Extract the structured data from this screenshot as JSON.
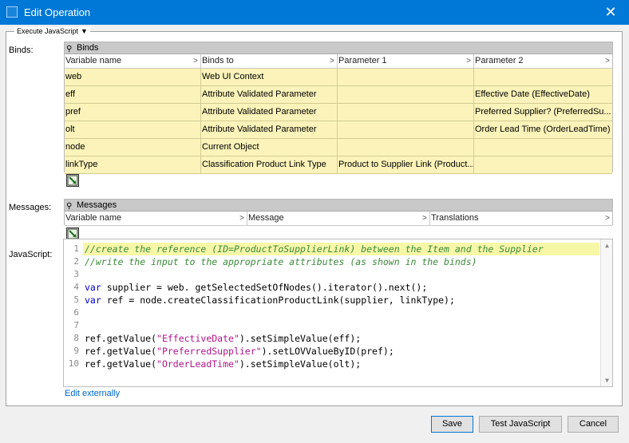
{
  "window": {
    "title": "Edit Operation",
    "close_glyph": "✕"
  },
  "panel": {
    "section_title": "Execute JavaScript",
    "section_caret": "▼"
  },
  "binds": {
    "label": "Binds:",
    "title": "Binds",
    "columns": [
      "Variable name",
      "Binds to",
      "Parameter 1",
      "Parameter 2"
    ],
    "rows": [
      [
        "web",
        "Web UI Context",
        "",
        ""
      ],
      [
        "eff",
        "Attribute Validated Parameter",
        "",
        "Effective Date (EffectiveDate)"
      ],
      [
        "pref",
        "Attribute Validated Parameter",
        "",
        "Preferred Supplier? (PreferredSu..."
      ],
      [
        "olt",
        "Attribute Validated Parameter",
        "",
        "Order Lead Time (OrderLeadTime)"
      ],
      [
        "node",
        "Current Object",
        "",
        ""
      ],
      [
        "linkType",
        "Classification Product Link Type",
        "Product to Supplier Link (Product...",
        ""
      ]
    ]
  },
  "messages": {
    "label": "Messages:",
    "title": "Messages",
    "columns": [
      "Variable name",
      "Message",
      "Translations"
    ]
  },
  "javascript": {
    "label": "JavaScript:",
    "line_numbers": [
      "1",
      "2",
      "3",
      "4",
      "5",
      "6",
      "7",
      "8",
      "9",
      "10"
    ],
    "edit_link": "Edit externally"
  },
  "icons": {
    "pin": "pin-icon",
    "add_row": "add-row-icon",
    "column_menu": "chevron-right-icon"
  },
  "buttons": {
    "save": "Save",
    "test": "Test JavaScript",
    "cancel": "Cancel"
  },
  "colors": {
    "titlebar": "#0078d7",
    "grid_cell": "#fbf3b9",
    "highlight_line": "#f7f7a8",
    "comment": "#3a8a3a",
    "keyword": "#0000cc",
    "string": "#b0158a",
    "link": "#0066cc"
  },
  "code": {
    "l1": "//create the reference (ID=ProductToSupplierLink) between the Item and the Supplier",
    "l2": "//write the input to the appropriate attributes (as shown in the binds)",
    "l4_kw": "var",
    "l4_rest": " supplier = web. getSelectedSetOfNodes().iterator().next();",
    "l5_kw": "var",
    "l5_rest": " ref = node.createClassificationProductLink(supplier, linkType);",
    "l8_a": "ref.getValue(",
    "l8_s": "\"EffectiveDate\"",
    "l8_b": ").setSimpleValue(eff);",
    "l9_a": "ref.getValue(",
    "l9_s": "\"PreferredSupplier\"",
    "l9_b": ").setLOVValueByID(pref);",
    "l10_a": "ref.getValue(",
    "l10_s": "\"OrderLeadTime\"",
    "l10_b": ").setSimpleValue(olt);"
  }
}
